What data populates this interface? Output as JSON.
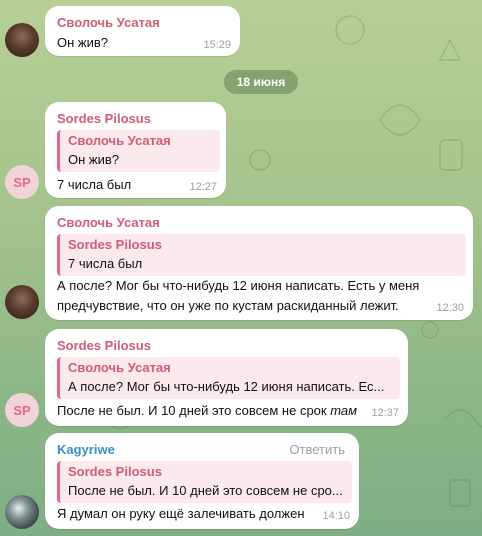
{
  "date_separator": "18 июня",
  "messages": [
    {
      "sender": "Сволочь Усатая",
      "text": "Он жив?",
      "time": "15:29"
    },
    {
      "sender": "Sordes Pilosus",
      "avatar_initials": "SP",
      "reply": {
        "name": "Сволочь Усатая",
        "text": "Он жив?"
      },
      "text": "7 числа был",
      "time": "12:27"
    },
    {
      "sender": "Сволочь Усатая",
      "reply": {
        "name": "Sordes Pilosus",
        "text": "7 числа был"
      },
      "text": "А после? Мог бы что-нибудь 12 июня написать. Есть у меня предчувствие, что он уже по кустам раскиданный лежит.",
      "time": "12:30"
    },
    {
      "sender": "Sordes Pilosus",
      "avatar_initials": "SP",
      "reply": {
        "name": "Сволочь Усатая",
        "text": "А после? Мог бы что-нибудь 12 июня написать. Ес..."
      },
      "text": "После не был. И 10 дней это совсем не срок",
      "text_italic": "там",
      "time": "12:37"
    },
    {
      "sender": "Kagyriwe",
      "reply_action": "Ответить",
      "reply": {
        "name": "Sordes Pilosus",
        "text": "После не был. И 10 дней это совсем не сро..."
      },
      "text": "Я думал он руку ещё залечивать должен",
      "time": "14:10"
    }
  ],
  "colors": {
    "accent_pink": "#e06a86",
    "accent_blue": "#3a8fc4",
    "background": "#a4c38c"
  }
}
